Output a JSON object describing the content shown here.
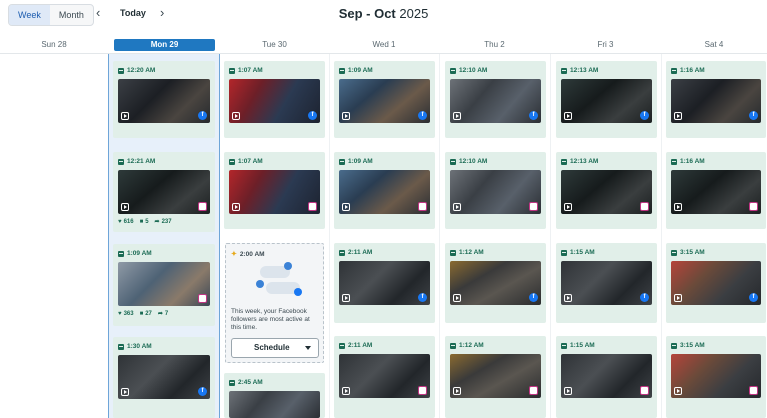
{
  "toolbar": {
    "view_week": "Week",
    "view_month": "Month",
    "prev": "‹",
    "next": "›",
    "today": "Today",
    "title_bold": "Sep - Oct",
    "title_year": "2025"
  },
  "days": [
    {
      "label": "Sun 28"
    },
    {
      "label": "Mon 29"
    },
    {
      "label": "Tue 30"
    },
    {
      "label": "Wed 1"
    },
    {
      "label": "Thu 2"
    },
    {
      "label": "Fri 3"
    },
    {
      "label": "Sat 4"
    }
  ],
  "posts": {
    "mon": [
      {
        "time": "12:20 AM",
        "network": "facebook",
        "net_glyph": "f"
      },
      {
        "time": "12:21 AM",
        "network": "instagram",
        "net_glyph": "◎",
        "likes": "616",
        "comments": "5",
        "shares": "237"
      },
      {
        "time": "1:09 AM",
        "network": "instagram",
        "net_glyph": "◎",
        "likes": "363",
        "comments": "27",
        "shares": "7"
      },
      {
        "time": "1:30 AM",
        "network": "facebook",
        "net_glyph": "f"
      }
    ],
    "tue": [
      {
        "time": "1:07 AM",
        "network": "facebook",
        "net_glyph": "f"
      },
      {
        "time": "1:07 AM",
        "network": "instagram",
        "net_glyph": "◎"
      },
      {
        "time": "2:45 AM",
        "network": "facebook",
        "net_glyph": "f"
      }
    ],
    "wed": [
      {
        "time": "1:09 AM",
        "network": "facebook",
        "net_glyph": "f"
      },
      {
        "time": "1:09 AM",
        "network": "instagram",
        "net_glyph": "◎"
      },
      {
        "time": "2:11 AM",
        "network": "facebook",
        "net_glyph": "f"
      },
      {
        "time": "2:11 AM",
        "network": "instagram",
        "net_glyph": "◎"
      }
    ],
    "thu": [
      {
        "time": "12:10 AM",
        "network": "facebook",
        "net_glyph": "f"
      },
      {
        "time": "12:10 AM",
        "network": "instagram",
        "net_glyph": "◎"
      },
      {
        "time": "1:12 AM",
        "network": "facebook",
        "net_glyph": "f"
      },
      {
        "time": "1:12 AM",
        "network": "instagram",
        "net_glyph": "◎"
      }
    ],
    "fri": [
      {
        "time": "12:13 AM",
        "network": "facebook",
        "net_glyph": "f"
      },
      {
        "time": "12:13 AM",
        "network": "instagram",
        "net_glyph": "◎"
      },
      {
        "time": "1:15 AM",
        "network": "facebook",
        "net_glyph": "f"
      },
      {
        "time": "1:15 AM",
        "network": "instagram",
        "net_glyph": "◎"
      }
    ],
    "sat": [
      {
        "time": "1:16 AM",
        "network": "facebook",
        "net_glyph": "f"
      },
      {
        "time": "1:16 AM",
        "network": "instagram",
        "net_glyph": "◎"
      },
      {
        "time": "3:15 AM",
        "network": "facebook",
        "net_glyph": "f"
      },
      {
        "time": "3:15 AM",
        "network": "instagram",
        "net_glyph": "◎"
      }
    ]
  },
  "suggestion": {
    "time": "2:00 AM",
    "text": "This week, your Facebook followers are most active at this time.",
    "button": "Schedule"
  },
  "colors": {
    "accent": "#1f78c1",
    "card_bg": "#e1efe9",
    "time_text": "#1b6b54",
    "facebook": "#1877f2",
    "instagram": "#c13584"
  }
}
